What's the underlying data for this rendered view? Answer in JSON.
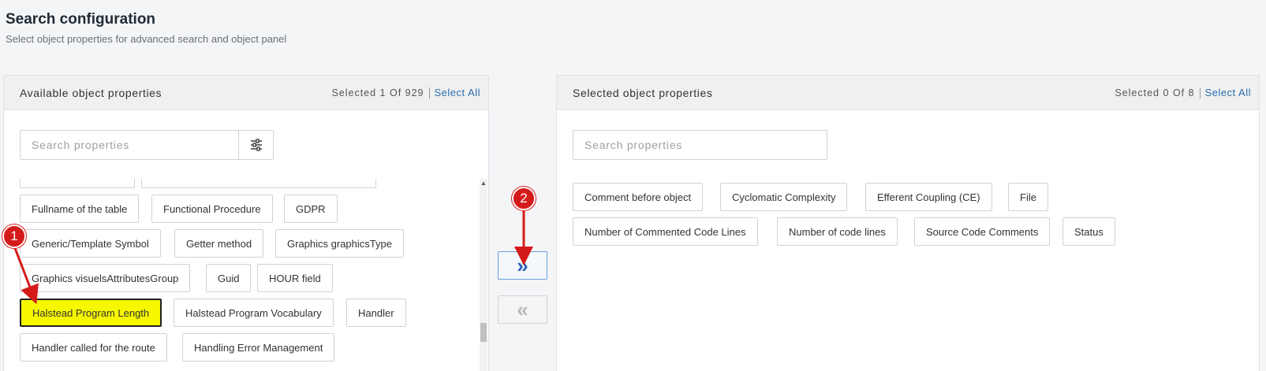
{
  "page": {
    "title": "Search configuration",
    "subtitle": "Select object properties for advanced search and object panel"
  },
  "available": {
    "title": "Available object properties",
    "count": "Selected 1 Of 929",
    "select_all": "Select All",
    "search_placeholder": "Search properties",
    "items": [
      "Fullname of the table",
      "Functional Procedure",
      "GDPR",
      "Generic/Template Symbol",
      "Getter method",
      "Graphics graphicsType",
      "Graphics visuelsAttributesGroup",
      "Guid",
      "HOUR field",
      "Halstead Program Length",
      "Halstead Program Vocabulary",
      "Handler",
      "Handler called for the route",
      "Handling Error Management"
    ]
  },
  "selected": {
    "title": "Selected object properties",
    "count": "Selected 0 Of 8",
    "select_all": "Select All",
    "search_placeholder": "Search properties",
    "items": [
      "Comment before object",
      "Cyclomatic Complexity",
      "Efferent Coupling (CE)",
      "File",
      "Number of Commented Code Lines",
      "Number of code lines",
      "Source Code Comments",
      "Status"
    ]
  },
  "controls": {
    "move_right_label": "»",
    "move_left_label": "«"
  },
  "annotations": {
    "step1": "1",
    "step2": "2",
    "color": "#d51a1a"
  },
  "colors": {
    "highlight": "#f7f700",
    "accent": "#2563b8",
    "link": "#2b6cb0"
  }
}
